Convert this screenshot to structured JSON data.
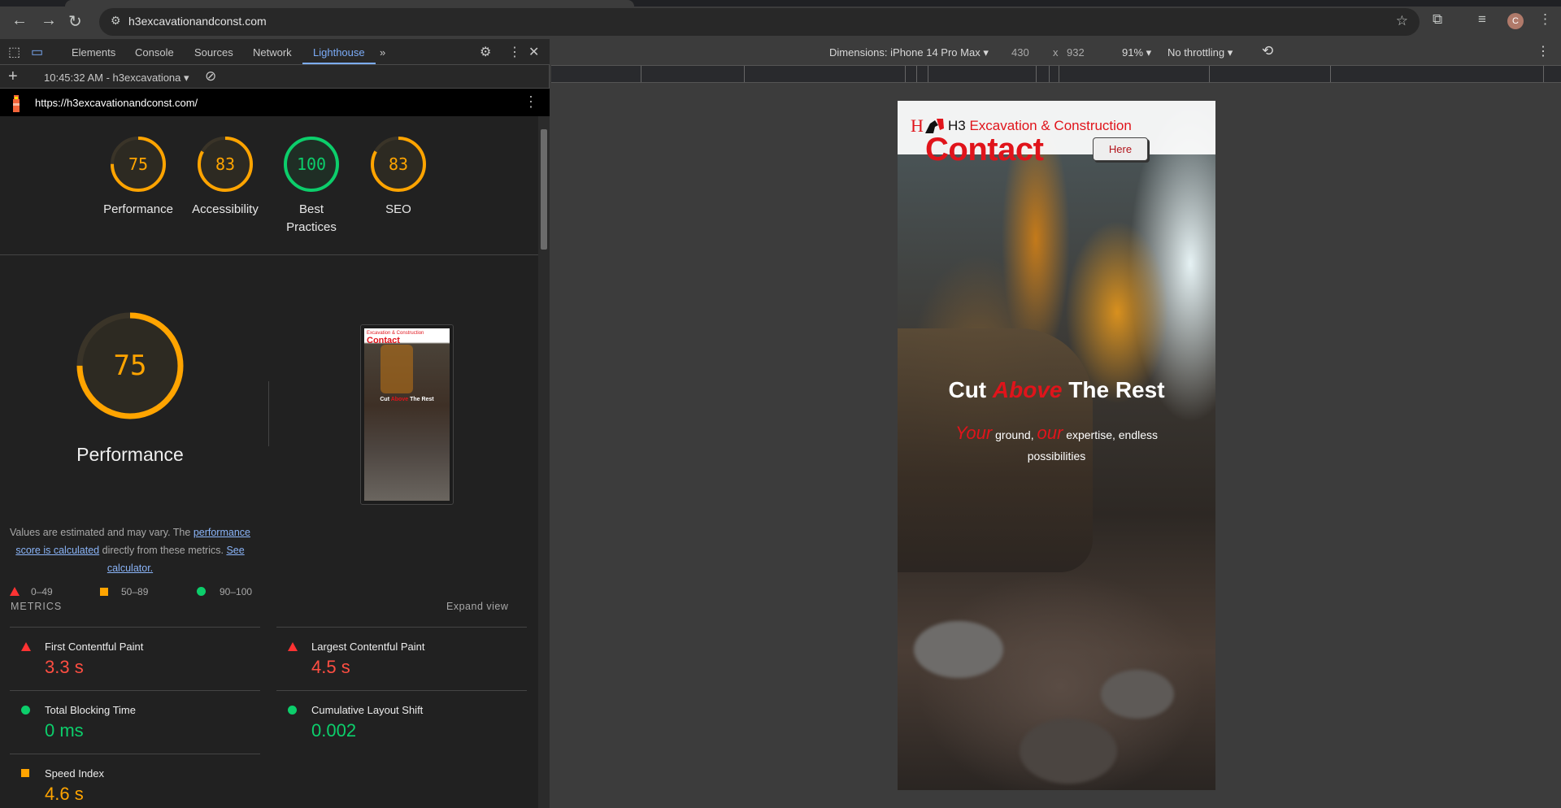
{
  "browser": {
    "url": "h3excavationandconst.com",
    "avatar_initial": "C"
  },
  "devtools": {
    "tabs": [
      "Elements",
      "Console",
      "Sources",
      "Network",
      "Lighthouse"
    ],
    "active_tab": "Lighthouse",
    "report_selector": "10:45:32 AM - h3excavationa",
    "report_url": "https://h3excavationandconst.com/"
  },
  "lighthouse": {
    "scores": [
      {
        "label": "Performance",
        "value": "75",
        "fraction": 0.75,
        "color": "#ffa400"
      },
      {
        "label": "Accessibility",
        "value": "83",
        "fraction": 0.83,
        "color": "#ffa400"
      },
      {
        "label": "Best Practices",
        "line1": "Best",
        "line2": "Practices",
        "value": "100",
        "fraction": 1.0,
        "color": "#0cce6b"
      },
      {
        "label": "SEO",
        "value": "83",
        "fraction": 0.83,
        "color": "#ffa400"
      }
    ],
    "main": {
      "value": "75",
      "fraction": 0.75,
      "title": "Performance"
    },
    "desc": {
      "pre": "Values are estimated and may vary. The ",
      "link1": "performance score is calculated",
      "mid": " directly from these metrics. ",
      "link2": "See calculator."
    },
    "legend": [
      "0–49",
      "50–89",
      "90–100"
    ],
    "metrics_title": "METRICS",
    "expand": "Expand view",
    "metrics": [
      {
        "name": "First Contentful Paint",
        "value": "3.3 s",
        "status": "fail",
        "color": "#ff4e42"
      },
      {
        "name": "Largest Contentful Paint",
        "value": "4.5 s",
        "status": "fail",
        "color": "#ff4e42"
      },
      {
        "name": "Total Blocking Time",
        "value": "0 ms",
        "status": "pass",
        "color": "#0cce6b"
      },
      {
        "name": "Cumulative Layout Shift",
        "value": "0.002",
        "status": "pass",
        "color": "#0cce6b"
      },
      {
        "name": "Speed Index",
        "value": "4.6 s",
        "status": "average",
        "color": "#ffa400"
      }
    ]
  },
  "device_toolbar": {
    "dimensions": "Dimensions: iPhone 14 Pro Max",
    "width": "430",
    "x": "x",
    "height": "932",
    "zoom": "91%",
    "throttling": "No throttling"
  },
  "site": {
    "logo_letter": "H",
    "brand_h3": "H3",
    "brand_rest": "Excavation & Construction",
    "contact": "Contact",
    "here": "Here",
    "headline": {
      "a": "Cut",
      "b": "Above",
      "c": "The Rest"
    },
    "tagline": {
      "a": "Your",
      "b": "ground,",
      "c": "our",
      "d": "expertise, endless possibilities"
    },
    "accent": "#e0141b"
  }
}
